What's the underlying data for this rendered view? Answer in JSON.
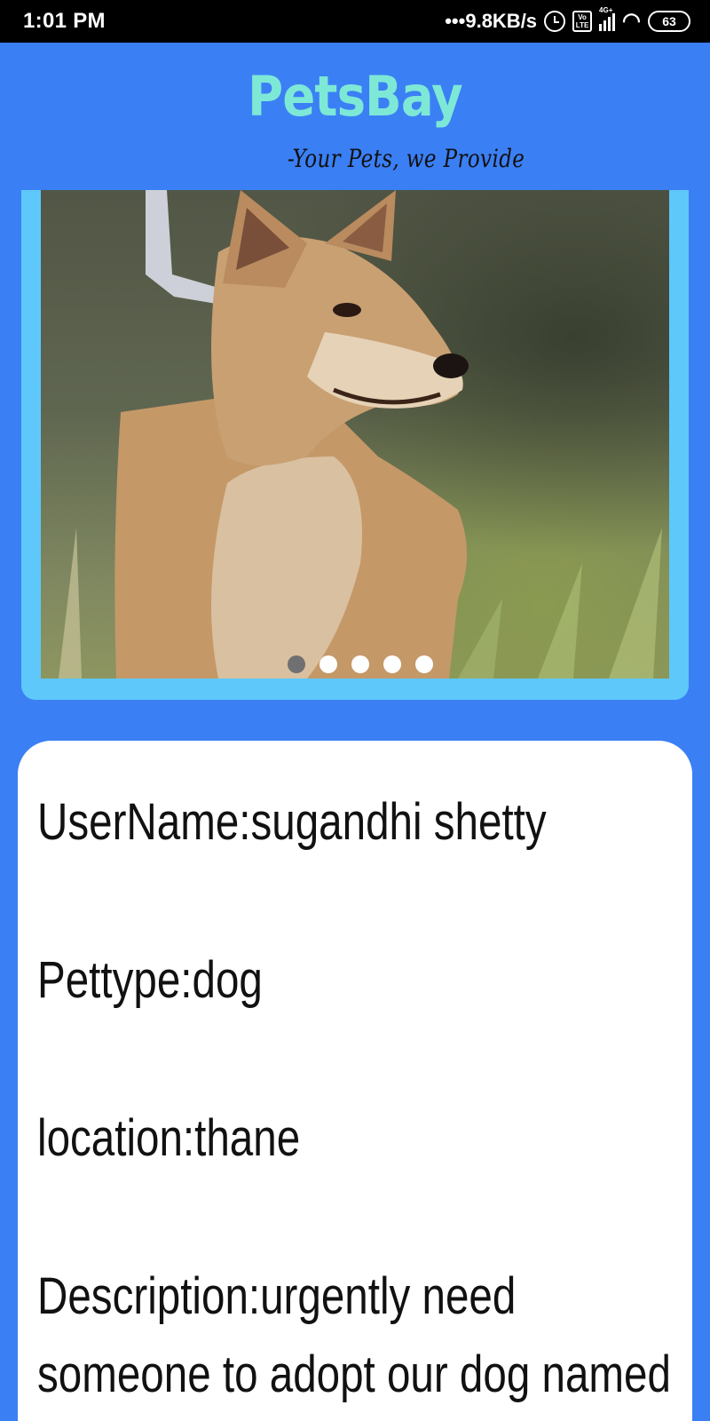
{
  "status_bar": {
    "time": "1:01 PM",
    "network_speed": "•••9.8KB/s",
    "volte_label_top": "Vo",
    "volte_label_bottom": "LTE",
    "signal_label": "4G+",
    "battery": "63",
    "icons": [
      "alarm-icon",
      "volte-icon",
      "signal-icon",
      "wifi-icon",
      "battery-icon"
    ]
  },
  "header": {
    "title": "PetsBay",
    "tagline": "-Your Pets, we Provide",
    "title_color": "#7ee8d6"
  },
  "carousel": {
    "slide_count": 5,
    "active_index": 0,
    "image_subject": "dog"
  },
  "details": {
    "username": "UserName:sugandhi shetty",
    "pettype": "Pettype:dog",
    "location": "location:thane",
    "description": "Description:urgently need someone to adopt our dog named"
  },
  "colors": {
    "background": "#3b7ff5",
    "carousel_frame": "#5ec8fb",
    "card": "#ffffff"
  }
}
